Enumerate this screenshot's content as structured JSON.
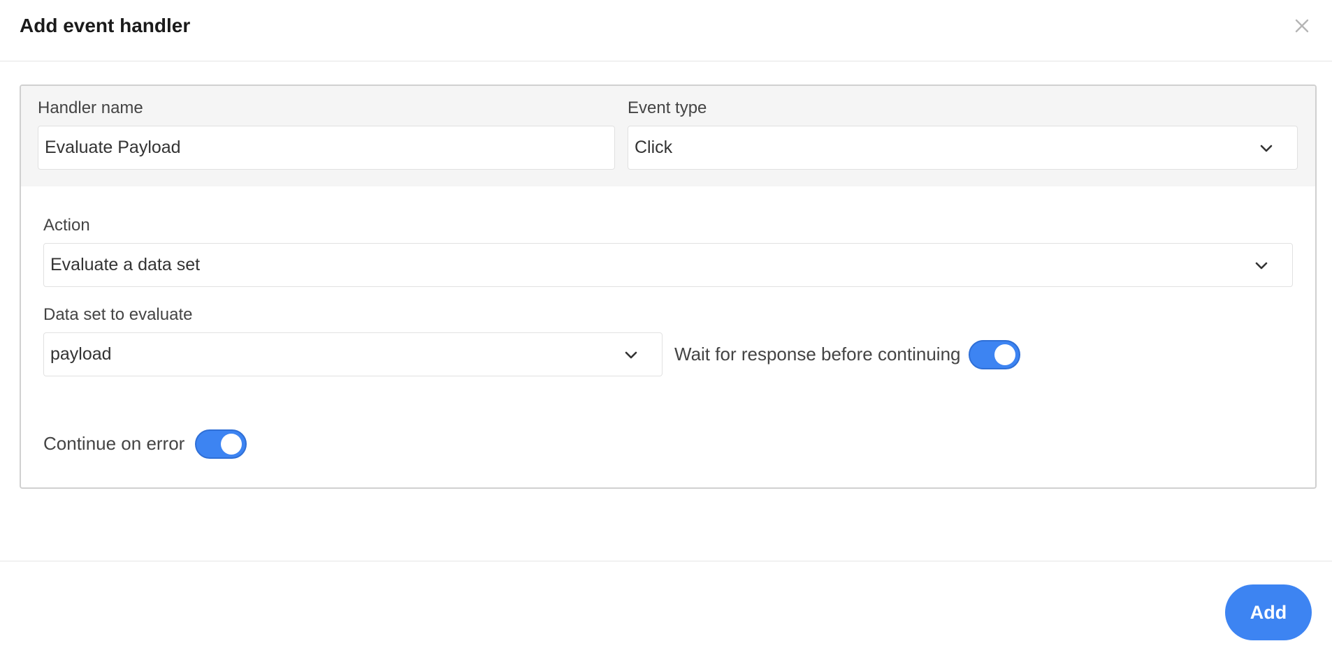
{
  "dialog": {
    "title": "Add event handler",
    "close_icon": "close-icon"
  },
  "form": {
    "handler_name": {
      "label": "Handler name",
      "value": "Evaluate Payload"
    },
    "event_type": {
      "label": "Event type",
      "value": "Click"
    },
    "action": {
      "label": "Action",
      "value": "Evaluate a data set"
    },
    "data_set": {
      "label": "Data set to evaluate",
      "value": "payload"
    },
    "wait_for_response": {
      "label": "Wait for response before continuing",
      "on": true
    },
    "continue_on_error": {
      "label": "Continue on error",
      "on": true
    }
  },
  "footer": {
    "add_label": "Add"
  },
  "colors": {
    "accent": "#3d84f2",
    "panel_top_bg": "#f5f5f5"
  }
}
